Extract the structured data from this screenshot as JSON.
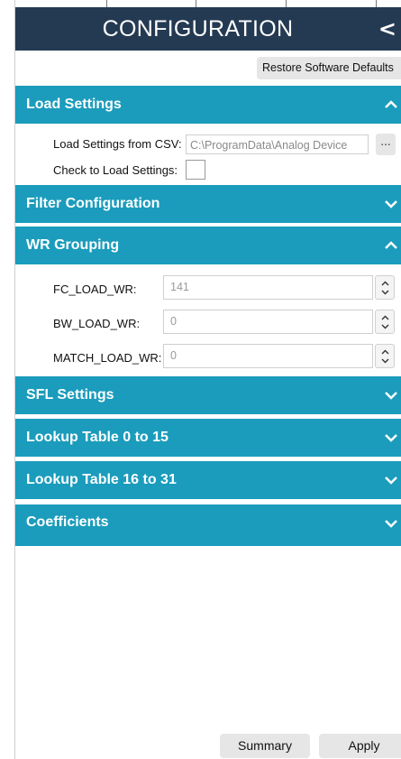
{
  "header": {
    "title": "CONFIGURATION",
    "collapse_glyph": "<"
  },
  "restore_button": "Restore Software Defaults",
  "sections": {
    "load_settings": {
      "title": "Load Settings",
      "expanded": true,
      "csv_label": "Load Settings from CSV:",
      "csv_value": "C:\\ProgramData\\Analog Device",
      "browse_label": "...",
      "check_label": "Check to Load Settings:",
      "checked": false
    },
    "filter_configuration": {
      "title": "Filter Configuration",
      "expanded": false
    },
    "wr_grouping": {
      "title": "WR Grouping",
      "expanded": true,
      "fields": [
        {
          "label": "FC_LOAD_WR:",
          "value": "141"
        },
        {
          "label": "BW_LOAD_WR:",
          "value": "0"
        },
        {
          "label": "MATCH_LOAD_WR:",
          "value": "0"
        }
      ]
    },
    "sfl_settings": {
      "title": "SFL Settings",
      "expanded": false
    },
    "lookup_0_15": {
      "title": "Lookup Table 0 to 15",
      "expanded": false
    },
    "lookup_16_31": {
      "title": "Lookup Table 16 to 31",
      "expanded": false
    },
    "coefficients": {
      "title": "Coefficients",
      "expanded": false
    }
  },
  "footer": {
    "summary_label": "Summary",
    "apply_label": "Apply"
  },
  "colors": {
    "header_bg": "#243a52",
    "section_bg": "#1b9cbc"
  }
}
